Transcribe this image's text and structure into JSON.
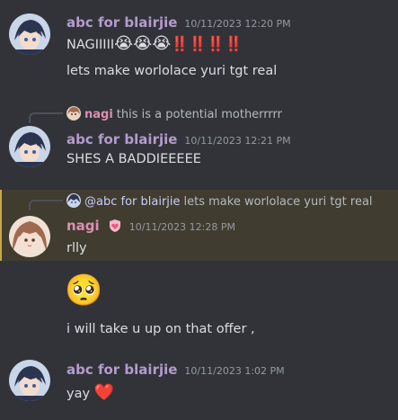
{
  "colors": {
    "background": "#313338",
    "username_abc": "#b49ccd",
    "username_nagi": "#dd8fb2",
    "highlight": "#403c2f",
    "mention": "#c9cdfb",
    "bangbang": "#e03a3a"
  },
  "messages": [
    {
      "author": "abc for blairjie",
      "timestamp": "10/11/2023 12:20 PM",
      "lines": [
        "NAGIIIII",
        "lets make worlolace yuri tgt real"
      ],
      "emojis": [
        "😭",
        "😭",
        "😭",
        "‼️",
        "‼️",
        "‼️",
        "‼️"
      ]
    },
    {
      "reply": {
        "author": "nagi",
        "text": "this is a potential motherrrrr"
      },
      "author": "abc for blairjie",
      "timestamp": "10/11/2023 12:21 PM",
      "lines": [
        "SHES  A BADDIEEEEE"
      ]
    },
    {
      "reply": {
        "author": "@abc for blairjie",
        "text": "lets make worlolace yuri tgt real"
      },
      "author": "nagi",
      "badge_icon": "heart-shield-icon",
      "timestamp": "10/11/2023 12:28 PM",
      "lines": [
        "rlly",
        "i will take u up on that offer ,"
      ],
      "big_emoji": "🥺"
    },
    {
      "author": "abc for blairjie",
      "timestamp": "10/11/2023 1:02 PM",
      "lines": [
        "yay"
      ],
      "emoji": "❤️"
    }
  ]
}
